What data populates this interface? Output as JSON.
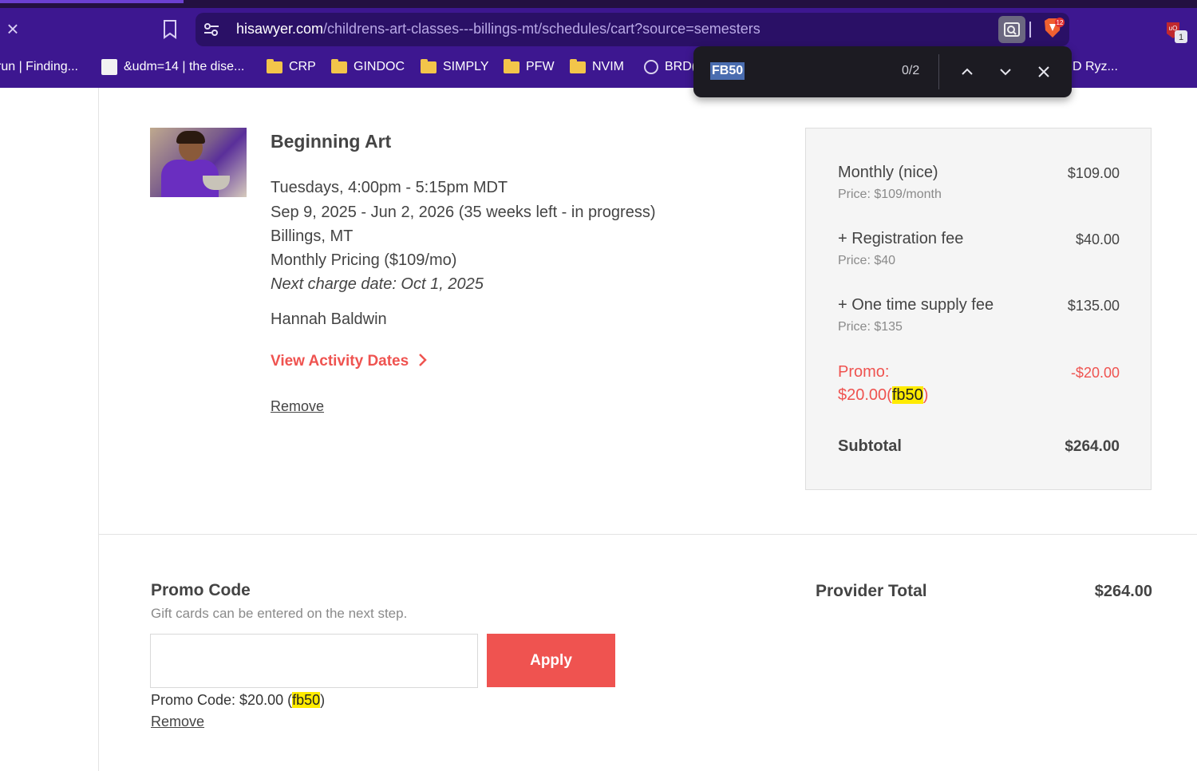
{
  "browser": {
    "url_host": "hisawyer.com",
    "url_path": "/childrens-art-classes---billings-mt/schedules/cart?source=semesters",
    "brave_badge": "12",
    "ext_badge": "1",
    "bookmarks": [
      {
        "label": "run | Finding..."
      },
      {
        "label": "&udm=14 | the dise..."
      },
      {
        "label": "CRP"
      },
      {
        "label": "GINDOC"
      },
      {
        "label": "SIMPLY"
      },
      {
        "label": "PFW"
      },
      {
        "label": "NVIM"
      },
      {
        "label": "BRD("
      },
      {
        "label": "D Ryz..."
      }
    ]
  },
  "find": {
    "query": "FB50",
    "count": "0/2"
  },
  "course": {
    "title": "Beginning Art",
    "schedule": "Tuesdays, 4:00pm - 5:15pm MDT",
    "dates": "Sep 9, 2025 - Jun 2, 2026 (35 weeks left - in progress)",
    "location": "Billings, MT",
    "pricing": "Monthly Pricing ($109/mo)",
    "next_charge": "Next charge date: Oct 1, 2025",
    "student": "Hannah Baldwin",
    "view_dates": "View Activity Dates",
    "remove": "Remove"
  },
  "summary": {
    "lines": [
      {
        "label": "Monthly (nice)",
        "sub": "Price: $109/month",
        "amount": "$109.00"
      },
      {
        "label": "+ Registration fee",
        "sub": "Price: $40",
        "amount": "$40.00"
      },
      {
        "label": "+ One time supply fee",
        "sub": "Price: $135",
        "amount": "$135.00"
      }
    ],
    "promo_label": "Promo:",
    "promo_value_prefix": "$20.00(",
    "promo_code": "fb50",
    "promo_value_suffix": ")",
    "promo_amount": "-$20.00",
    "subtotal_label": "Subtotal",
    "subtotal_amount": "$264.00"
  },
  "promo_section": {
    "title": "Promo Code",
    "hint": "Gift cards can be entered on the next step.",
    "input_value": "",
    "apply_label": "Apply",
    "applied_prefix": "Promo Code: $20.00 (",
    "applied_code": "fb50",
    "applied_suffix": ")",
    "remove": "Remove"
  },
  "provider": {
    "label": "Provider Total",
    "amount": "$264.00"
  },
  "colors": {
    "brand_purple": "#3d1790",
    "accent_red": "#ef5350",
    "highlight": "#ffeb00"
  }
}
